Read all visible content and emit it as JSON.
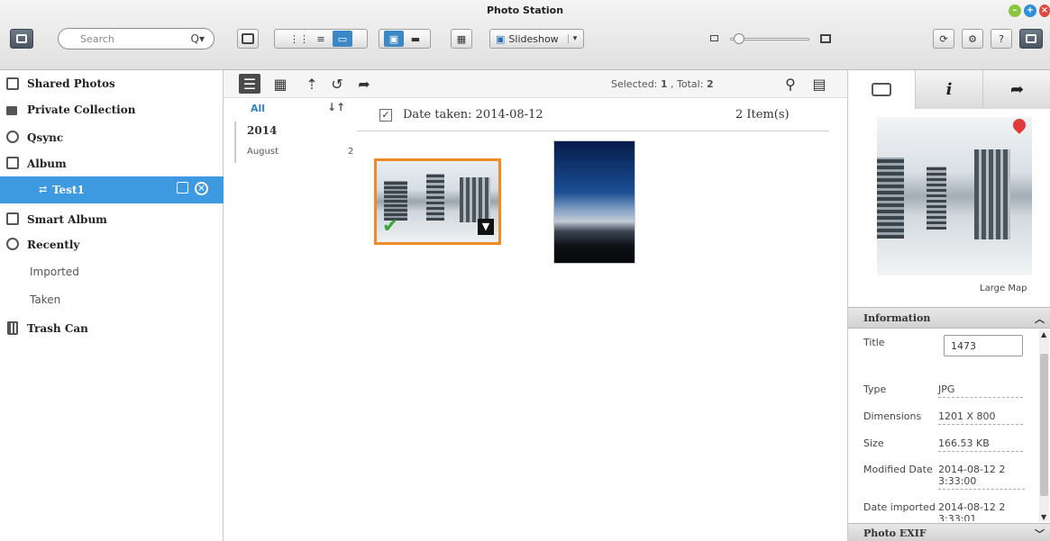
{
  "window": {
    "title": "Photo Station"
  },
  "toolbar": {
    "search_placeholder": "Search",
    "search_icon": "Q▾",
    "slideshow_label": "Slideshow",
    "colors": {
      "accent": "#3d9ae0",
      "selection": "#f08a24"
    }
  },
  "sidebar": {
    "items": [
      {
        "label": "Shared Photos",
        "icon": "photo-icon"
      },
      {
        "label": "Private Collection",
        "icon": "lock-icon"
      },
      {
        "label": "Qsync",
        "icon": "sync-icon"
      },
      {
        "label": "Album",
        "icon": "album-icon"
      },
      {
        "label": "Test1",
        "icon": "share-icon"
      },
      {
        "label": "Smart Album",
        "icon": "smart-album-icon"
      },
      {
        "label": "Recently",
        "icon": "clock-icon"
      },
      {
        "label": "Imported"
      },
      {
        "label": "Taken"
      },
      {
        "label": "Trash Can",
        "icon": "trash-icon"
      }
    ]
  },
  "content_toolbar": {
    "selected_label": "Selected: ",
    "selected_count": "1",
    "total_label": " , Total: ",
    "total_count": "2"
  },
  "timeline": {
    "all": "All",
    "sort_icon": "↓↑",
    "year": "2014",
    "month": "August",
    "month_count": "2"
  },
  "group": {
    "label": "Date taken: 2014-08-12",
    "count": "2 Item(s)"
  },
  "right_panel": {
    "large_map": "Large Map",
    "info_tab_icon": "i",
    "information": "Information",
    "fields": {
      "title_label": "Title",
      "title_value": "1473",
      "type_label": "Type",
      "type_value": "JPG",
      "dimensions_label": "Dimensions",
      "dimensions_value": "1201 X 800",
      "size_label": "Size",
      "size_value": "166.53 KB",
      "modified_label": "Modified Date",
      "modified_value": "2014-08-12 2 3:33:00",
      "imported_label": "Date imported",
      "imported_value": "2014-08-12 2 3:33:01"
    },
    "photo_exif": "Photo EXIF"
  }
}
